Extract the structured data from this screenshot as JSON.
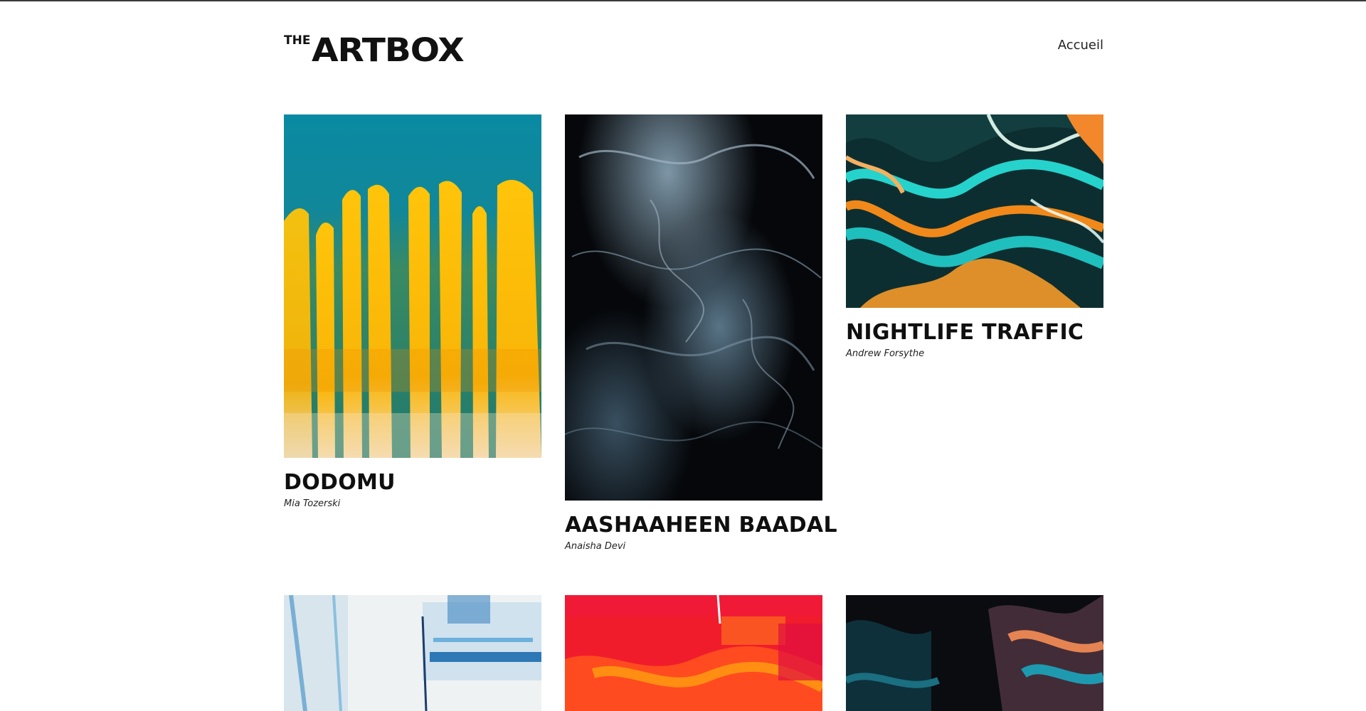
{
  "site": {
    "logo_prefix": "THE",
    "logo_main": "ARTBOX"
  },
  "nav": {
    "home_label": "Accueil"
  },
  "artworks": [
    {
      "title": "DODOMU",
      "artist": "Mia Tozerski",
      "palette": [
        "#0e8fa6",
        "#f8b80a"
      ]
    },
    {
      "title": "AASHAAHEEN BAADAL",
      "artist": "Anaisha Devi",
      "palette": [
        "#050608",
        "#6f8ea3"
      ]
    },
    {
      "title": "NIGHTLIFE TRAFFIC",
      "artist": "Andrew Forsythe",
      "palette": [
        "#0f2f30",
        "#22d6d0",
        "#f28a1b"
      ]
    }
  ],
  "row2_palettes": [
    [
      "#e9eef1",
      "#2e7fb8"
    ],
    [
      "#f41d2e",
      "#ff7a12"
    ],
    [
      "#0b0d10",
      "#e07c4d",
      "#1c8fa0"
    ]
  ]
}
